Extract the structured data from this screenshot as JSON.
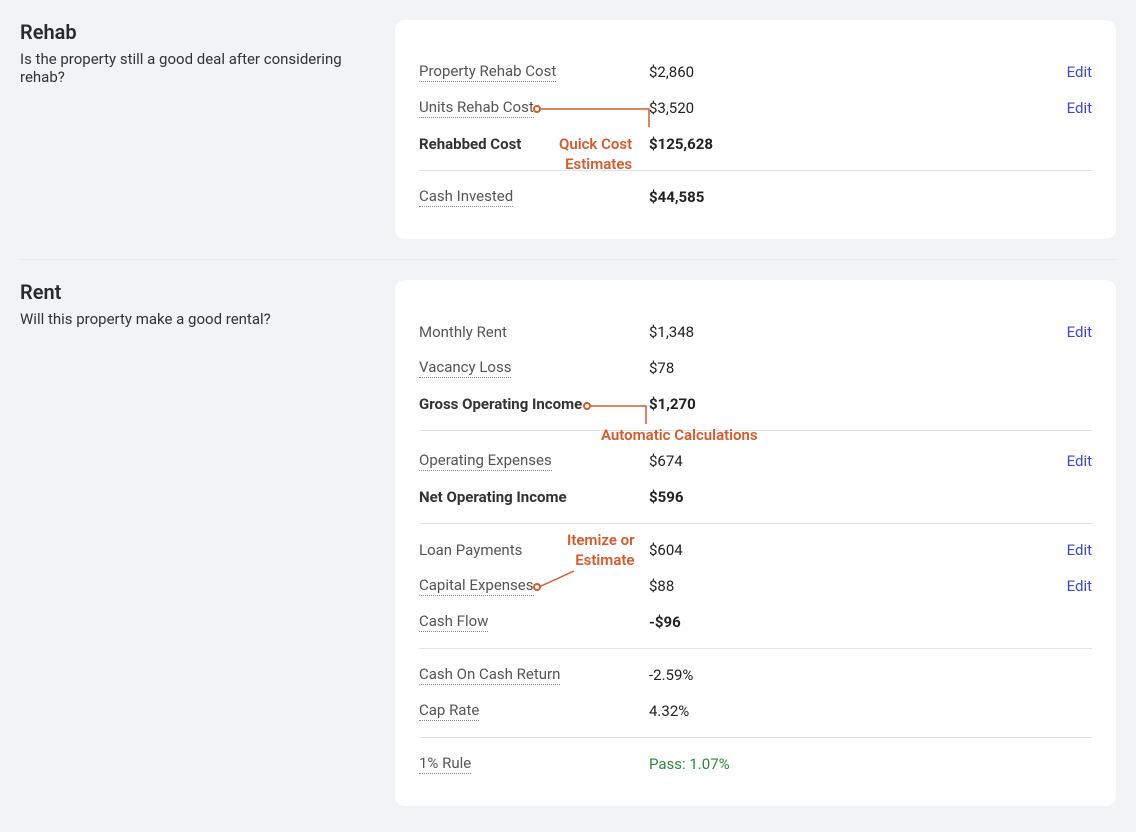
{
  "rehab": {
    "title": "Rehab",
    "subtitle": "Is the property still a good deal after considering rehab?",
    "rows": {
      "property_rehab_cost": {
        "label": "Property Rehab Cost",
        "value": "$2,860",
        "edit": "Edit"
      },
      "units_rehab_cost": {
        "label": "Units Rehab Cost",
        "value": "$3,520",
        "edit": "Edit"
      },
      "rehabbed_cost": {
        "label": "Rehabbed Cost",
        "value": "$125,628"
      },
      "cash_invested": {
        "label": "Cash Invested",
        "value": "$44,585"
      }
    },
    "annotation": "Quick Cost\nEstimates",
    "annotation_l1": "Quick Cost",
    "annotation_l2": "Estimates"
  },
  "rent": {
    "title": "Rent",
    "subtitle": "Will this property make a good rental?",
    "rows": {
      "monthly_rent": {
        "label": "Monthly Rent",
        "value": "$1,348",
        "edit": "Edit"
      },
      "vacancy_loss": {
        "label": "Vacancy Loss",
        "value": "$78"
      },
      "gross_operating_income": {
        "label": "Gross Operating Income",
        "value": "$1,270"
      },
      "operating_expenses": {
        "label": "Operating Expenses",
        "value": "$674",
        "edit": "Edit"
      },
      "net_operating_income": {
        "label": "Net Operating Income",
        "value": "$596"
      },
      "loan_payments": {
        "label": "Loan Payments",
        "value": "$604",
        "edit": "Edit"
      },
      "capital_expenses": {
        "label": "Capital Expenses",
        "value": "$88",
        "edit": "Edit"
      },
      "cash_flow": {
        "label": "Cash Flow",
        "value": "-$96"
      },
      "cash_on_cash_return": {
        "label": "Cash On Cash Return",
        "value": "-2.59%"
      },
      "cap_rate": {
        "label": "Cap Rate",
        "value": "4.32%"
      },
      "one_pct_rule": {
        "label": "1% Rule",
        "value": "Pass: 1.07%"
      }
    },
    "annotation_auto": "Automatic Calculations",
    "annotation_itemize_l1": "Itemize or",
    "annotation_itemize_l2": "Estimate"
  }
}
